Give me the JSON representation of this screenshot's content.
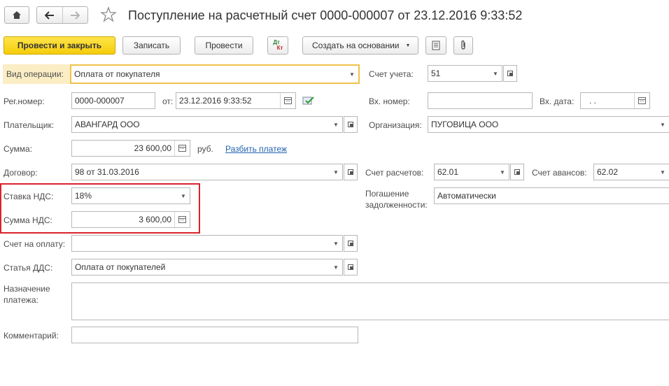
{
  "window": {
    "title": "Поступление на расчетный счет 0000-000007 от 23.12.2016 9:33:52"
  },
  "toolbar": {
    "post_close_label": "Провести и закрыть",
    "save_label": "Записать",
    "post_label": "Провести",
    "dtkt_top": "Дт",
    "dtkt_bottom": "Кт",
    "create_based_label": "Создать на основании"
  },
  "form": {
    "operation_type": {
      "label": "Вид операции:",
      "value": "Оплата от покупателя"
    },
    "account": {
      "label": "Счет учета:",
      "value": "51"
    },
    "reg_number": {
      "label": "Рег.номер:",
      "value": "0000-000007"
    },
    "date": {
      "label": "от:",
      "value": "23.12.2016  9:33:52"
    },
    "incoming_number": {
      "label": "Вх. номер:",
      "value": ""
    },
    "incoming_date": {
      "label": "Вх. дата:",
      "value": " .  ."
    },
    "payer": {
      "label": "Плательщик:",
      "value": "АВАНГАРД ООО"
    },
    "organization": {
      "label": "Организация:",
      "value": "ПУГОВИЦА ООО"
    },
    "amount": {
      "label": "Сумма:",
      "value": "23 600,00",
      "currency": "руб.",
      "split_link": "Разбить платеж"
    },
    "contract": {
      "label": "Договор:",
      "value": "98 от 31.03.2016"
    },
    "settlement_account": {
      "label": "Счет расчетов:",
      "value": "62.01"
    },
    "advance_account": {
      "label": "Счет авансов:",
      "value": "62.02"
    },
    "vat_rate": {
      "label": "Ставка НДС:",
      "value": "18%"
    },
    "debt_repayment": {
      "label_line1": "Погашение",
      "label_line2": "задолженности:",
      "value": "Автоматически"
    },
    "vat_amount": {
      "label": "Сумма НДС:",
      "value": "3 600,00"
    },
    "invoice": {
      "label": "Счет на оплату:",
      "value": ""
    },
    "cash_flow_item": {
      "label": "Статья ДДС:",
      "value": "Оплата от покупателей"
    },
    "purpose": {
      "label_line1": "Назначение",
      "label_line2": "платежа:",
      "value": ""
    },
    "comment": {
      "label": "Комментарий:",
      "value": ""
    }
  },
  "colors": {
    "highlight_box": "#d9232b",
    "primary_button": "#f5cc0a",
    "focused_field_border": "#f0c24a",
    "link": "#2163b0"
  }
}
